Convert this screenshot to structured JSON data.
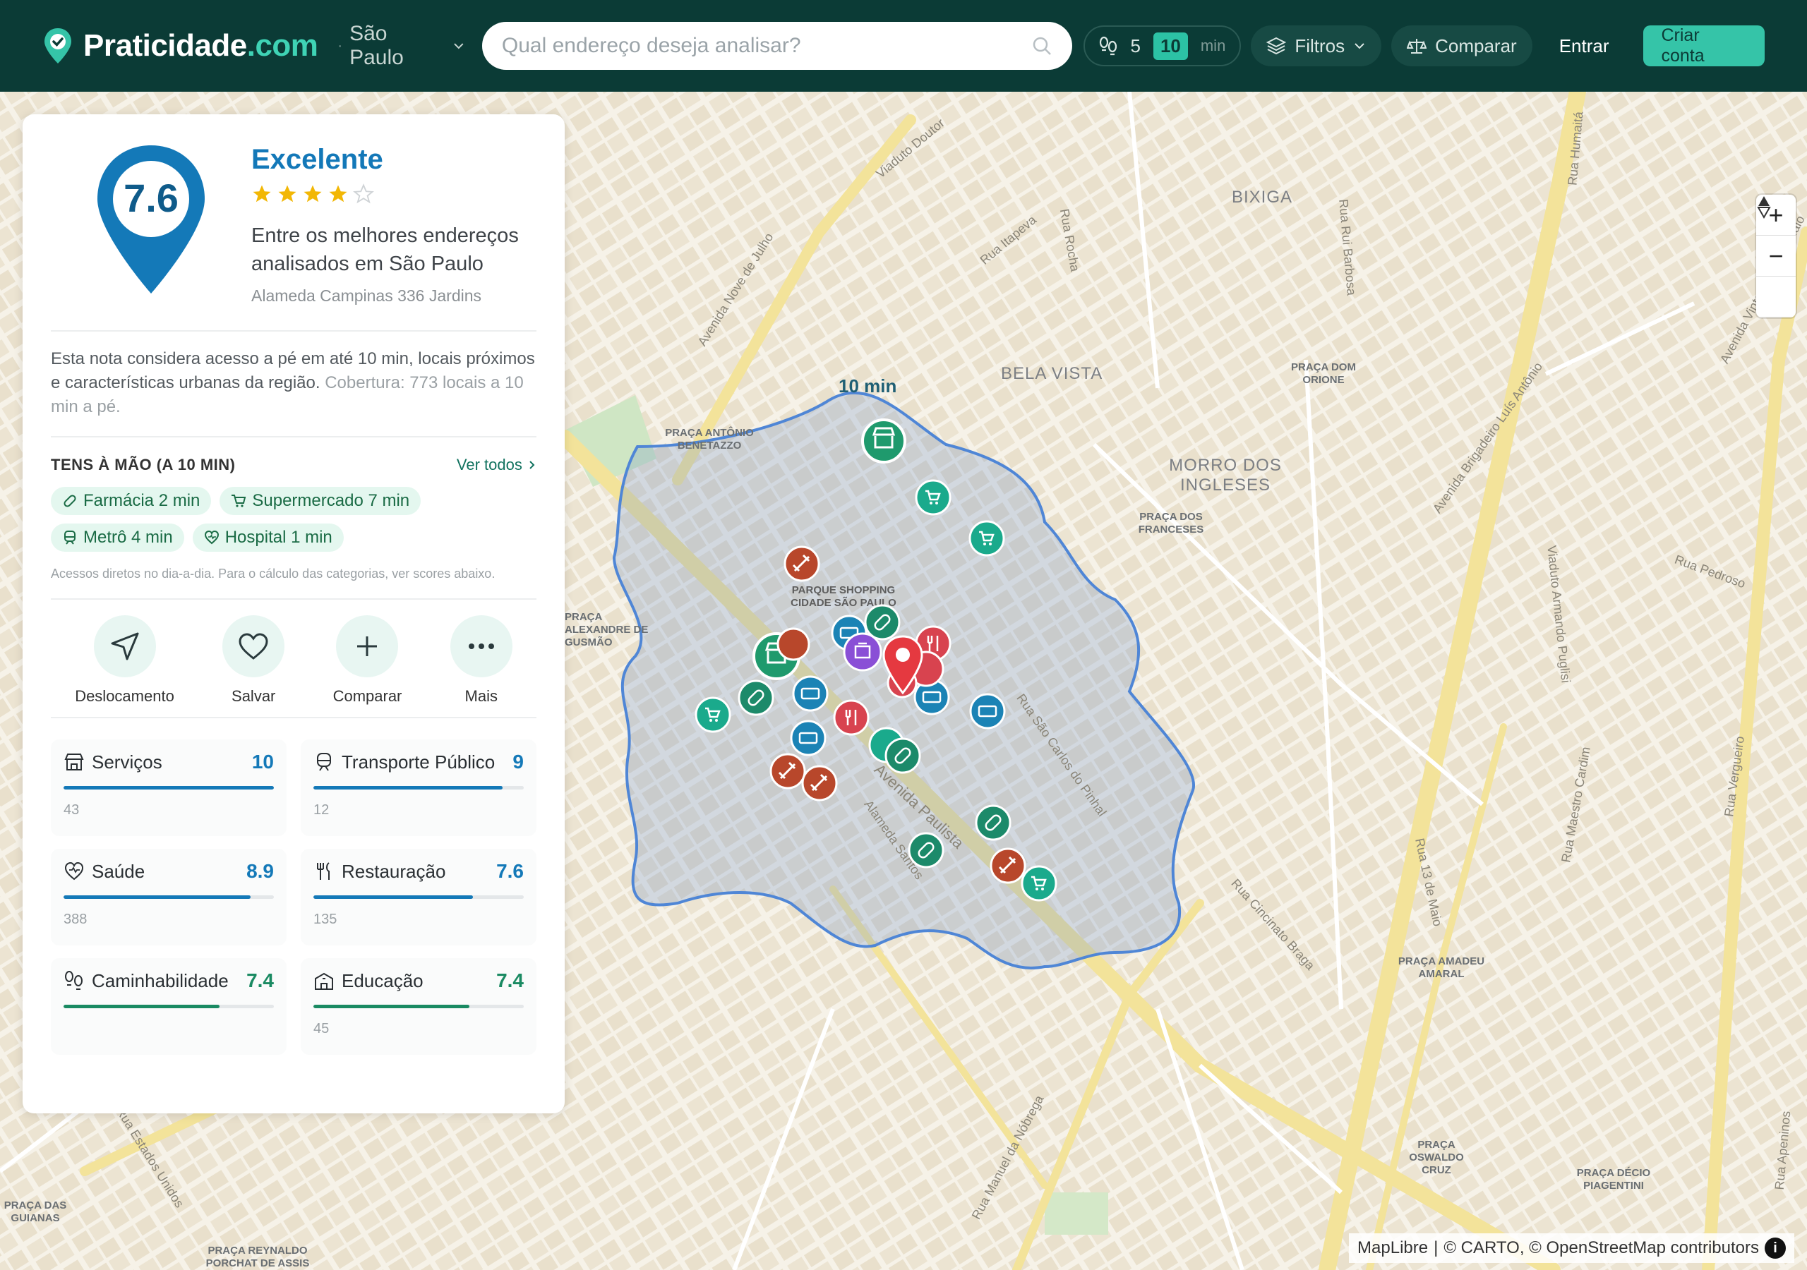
{
  "brand": {
    "name": "Praticidade",
    "domain": ".com"
  },
  "header": {
    "city": "São Paulo",
    "city_separator": "·",
    "search_placeholder": "Qual endereço deseja analisar?",
    "time_options": [
      "5",
      "10"
    ],
    "time_selected": "10",
    "time_unit": "min",
    "filters_label": "Filtros",
    "compare_label": "Comparar",
    "login_label": "Entrar",
    "signup_label": "Criar conta"
  },
  "panel": {
    "score": "7.6",
    "rating_label": "Excelente",
    "stars": 4,
    "description": "Entre os melhores endereços analisados em São Paulo",
    "address": "Alameda Campinas 336 Jardins",
    "note": "Esta nota considera acesso a pé em até 10 min, locais próximos e características urbanas da região.",
    "coverage": "Cobertura: 773 locais a 10 min a pé.",
    "quick_title": "TENS À MÃO (A 10 MIN)",
    "view_all": "Ver todos",
    "quick_items": [
      {
        "label": "Farmácia 2 min",
        "icon": "pill-icon"
      },
      {
        "label": "Supermercado 7 min",
        "icon": "cart-icon"
      },
      {
        "label": "Metrô 4 min",
        "icon": "metro-icon"
      },
      {
        "label": "Hospital 1 min",
        "icon": "heart-icon"
      }
    ],
    "quick_note": "Acessos diretos no dia-a-dia. Para o cálculo das categorias, ver scores abaixo.",
    "actions": [
      {
        "label": "Deslocamento",
        "icon": "navigation-icon"
      },
      {
        "label": "Salvar",
        "icon": "heart-icon"
      },
      {
        "label": "Comparar",
        "icon": "plus-icon"
      },
      {
        "label": "Mais",
        "icon": "more-icon"
      }
    ],
    "categories": [
      {
        "name": "Serviços",
        "score": "10",
        "count": "43",
        "fill": 1.0,
        "color": "#1479b8",
        "icon": "store-icon"
      },
      {
        "name": "Transporte Público",
        "score": "9",
        "count": "12",
        "fill": 0.9,
        "color": "#1479b8",
        "icon": "metro-icon"
      },
      {
        "name": "Saúde",
        "score": "8.9",
        "count": "388",
        "fill": 0.89,
        "color": "#1479b8",
        "icon": "heart-icon"
      },
      {
        "name": "Restauração",
        "score": "7.6",
        "count": "135",
        "fill": 0.76,
        "color": "#1479b8",
        "icon": "fork-knife-icon"
      },
      {
        "name": "Caminhabilidade",
        "score": "7.4",
        "count": "",
        "fill": 0.74,
        "color": "#1a8a62",
        "icon": "footprints-icon"
      },
      {
        "name": "Educação",
        "score": "7.4",
        "count": "45",
        "fill": 0.74,
        "color": "#1a8a62",
        "icon": "school-icon"
      }
    ]
  },
  "map": {
    "isochrone_label": "10 min",
    "neighborhoods": [
      "BIXIGA",
      "BELA VISTA",
      "MORRO DOS INGLESES"
    ],
    "plazas": [
      "PRAÇA ANTÔNIO BENETAZZO",
      "PRAÇA DOM ORIONE",
      "PRAÇA DOS FRANCESES",
      "PARQUE SHOPPING CIDADE SÃO PAULO",
      "PRAÇA ALEXANDRE DE GUSMÃO",
      "PRAÇA AMADEU AMARAL",
      "PRAÇA OSWALDO CRUZ",
      "PRAÇA DÉCIO PIAGENTINI",
      "PRAÇA DAS GUIANAS",
      "PRAÇA REYNALDO PORCHAT DE ASSIS"
    ],
    "streets": [
      "Avenida Paulista",
      "Avenida Nove de Julho",
      "Viaduto Doutor",
      "Rua Itapeva",
      "Rua Rocha",
      "Rua Rui Barbosa",
      "Rua Humaitá",
      "Avenida Vinte e Três de Maio",
      "Rua Pedroso",
      "Avenida Brigadeiro Luís Antônio",
      "Viaduto Armando Puglisi",
      "Rua São Carlos do Pinhal",
      "Alameda Santos",
      "Rua 13 de Maio",
      "Rua Maestro Cardim",
      "Rua Vergueiro",
      "Rua Cincinato Braga",
      "Rua Manuel da Nóbrega",
      "Rua Estados Unidos",
      "Rua Apeninos"
    ],
    "attribution_parts": [
      "MapLibre",
      "|",
      "© CARTO, © OpenStreetMap contributors"
    ],
    "zoom_in": "+",
    "zoom_out": "−"
  },
  "colors": {
    "header_bg": "#0b3b36",
    "accent": "#35c4a8",
    "score_blue": "#1479b8",
    "marker_red": "#e53940",
    "isochrone_stroke": "#3f7fd0"
  }
}
